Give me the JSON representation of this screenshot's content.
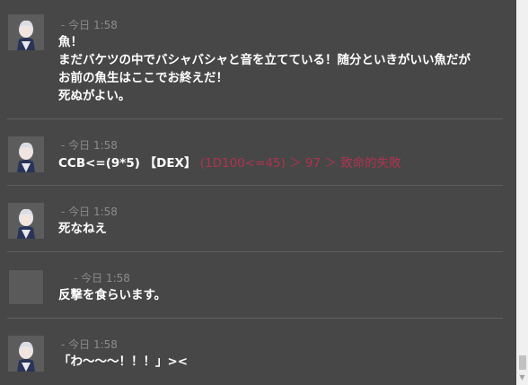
{
  "messages": [
    {
      "avatar": "character-avatar",
      "meta": "- 今日 1:58",
      "lines": [
        "魚！",
        "まだバケツの中でバシャバシャと音を立てている！随分といきがいい魚だが",
        "お前の魚生はここでお終えだ！",
        "死ぬがよい。"
      ]
    },
    {
      "avatar": "character-avatar",
      "meta": "- 今日 1:58",
      "dice_command": "CCB<=(9*5) 【DEX】",
      "dice_result": "(1D100<=45) ＞ 97 ＞ 致命的失敗"
    },
    {
      "avatar": "character-avatar",
      "meta": "- 今日 1:58",
      "text": "死なねえ"
    },
    {
      "avatar": "blank-avatar",
      "meta": "- 今日 1:58",
      "text": "反撃を食らいます。"
    },
    {
      "avatar": "character-avatar",
      "meta": "- 今日 1:58",
      "text": "「わ〜〜〜！！！」><"
    }
  ],
  "colors": {
    "background": "#474747",
    "text": "#ffffff",
    "meta": "#8c8c8c",
    "critical_fail": "#b13350"
  }
}
